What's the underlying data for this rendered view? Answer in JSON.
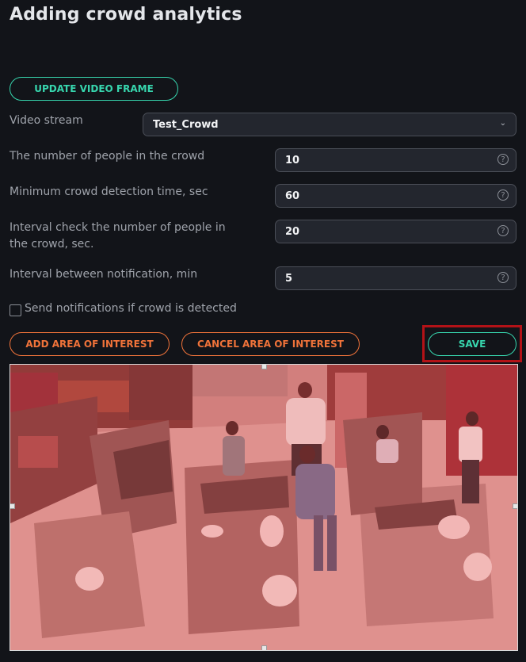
{
  "page": {
    "title": "Adding crowd analytics"
  },
  "buttons": {
    "update_frame": "UPDATE VIDEO FRAME",
    "add_area": "ADD AREA OF INTEREST",
    "cancel_area": "CANCEL AREA OF INTEREST",
    "save": "SAVE"
  },
  "form": {
    "video_stream": {
      "label": "Video stream",
      "value": "Test_Crowd"
    },
    "people_count": {
      "label": "The number of people in the crowd",
      "value": "10"
    },
    "min_detection_time": {
      "label": "Minimum crowd detection time, sec",
      "value": "60"
    },
    "interval_check": {
      "label": "Interval check the number of people in the crowd, sec.",
      "value": "20"
    },
    "notification_interval": {
      "label": "Interval between notification, min",
      "value": "5"
    },
    "send_notifications": {
      "label": "Send notifications if crowd is detected",
      "checked": false
    }
  },
  "colors": {
    "accent_green": "#37d6ae",
    "accent_orange": "#f0733a",
    "highlight_red": "#b31217",
    "background": "#121419"
  },
  "icons": {
    "help": "help-circle-icon",
    "dropdown": "chevron-down-icon"
  }
}
